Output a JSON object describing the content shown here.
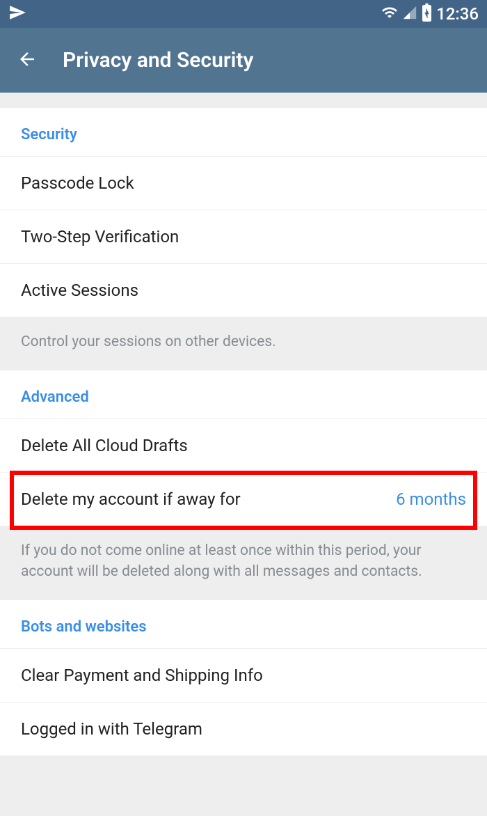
{
  "status": {
    "time": "12:36"
  },
  "header": {
    "title": "Privacy and Security"
  },
  "sections": {
    "security": {
      "header": "Security",
      "items": {
        "passcode": "Passcode Lock",
        "twostep": "Two-Step Verification",
        "sessions": "Active Sessions"
      },
      "footer": "Control your sessions on other devices."
    },
    "advanced": {
      "header": "Advanced",
      "items": {
        "deleteDrafts": "Delete All Cloud Drafts",
        "deleteAccount": {
          "label": "Delete my account if away for",
          "value": "6 months"
        }
      },
      "footer": "If you do not come online at least once within this period, your account will be deleted along with all messages and contacts."
    },
    "bots": {
      "header": "Bots and websites",
      "items": {
        "clearPayment": "Clear Payment and Shipping Info",
        "loggedIn": "Logged in with Telegram"
      }
    }
  }
}
